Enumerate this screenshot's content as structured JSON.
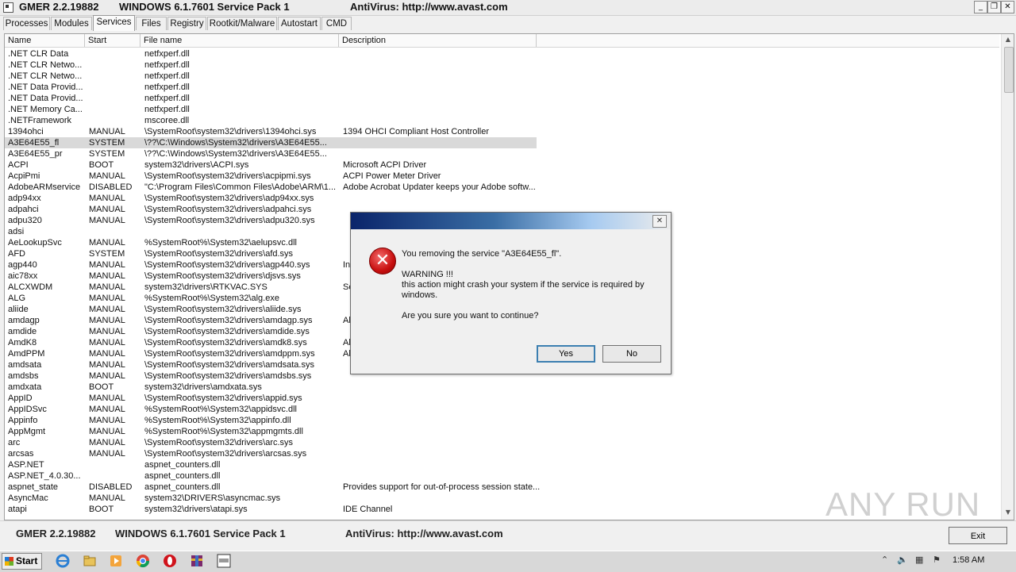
{
  "window": {
    "title_app": "GMER 2.2.19882",
    "title_os": "WINDOWS 6.1.7601 Service Pack 1",
    "title_av": "AntiVirus: http://www.avast.com",
    "minimize": "_",
    "restore": "❐",
    "close": "✕"
  },
  "tabs": [
    {
      "label": "Processes"
    },
    {
      "label": "Modules"
    },
    {
      "label": "Services"
    },
    {
      "label": "Files"
    },
    {
      "label": "Registry"
    },
    {
      "label": "Rootkit/Malware"
    },
    {
      "label": "Autostart"
    },
    {
      "label": "CMD"
    }
  ],
  "active_tab": "Services",
  "columns": [
    "Name",
    "Start",
    "File name",
    "Description"
  ],
  "rows": [
    [
      ".NET CLR Data",
      "",
      "netfxperf.dll",
      ""
    ],
    [
      ".NET CLR Netwo...",
      "",
      "netfxperf.dll",
      ""
    ],
    [
      ".NET CLR Netwo...",
      "",
      "netfxperf.dll",
      ""
    ],
    [
      ".NET Data Provid...",
      "",
      "netfxperf.dll",
      ""
    ],
    [
      ".NET Data Provid...",
      "",
      "netfxperf.dll",
      ""
    ],
    [
      ".NET Memory Ca...",
      "",
      "netfxperf.dll",
      ""
    ],
    [
      ".NETFramework",
      "",
      "mscoree.dll",
      ""
    ],
    [
      "1394ohci",
      "MANUAL",
      "\\SystemRoot\\system32\\drivers\\1394ohci.sys",
      "1394 OHCI Compliant Host Controller"
    ],
    [
      "A3E64E55_fl",
      "SYSTEM",
      "\\??\\C:\\Windows\\System32\\drivers\\A3E64E55...",
      ""
    ],
    [
      "A3E64E55_pr",
      "SYSTEM",
      "\\??\\C:\\Windows\\System32\\drivers\\A3E64E55...",
      ""
    ],
    [
      "ACPI",
      "BOOT",
      "system32\\drivers\\ACPI.sys",
      "Microsoft ACPI Driver"
    ],
    [
      "AcpiPmi",
      "MANUAL",
      "\\SystemRoot\\system32\\drivers\\acpipmi.sys",
      "ACPI Power Meter Driver"
    ],
    [
      "AdobeARMservice",
      "DISABLED",
      "\"C:\\Program Files\\Common Files\\Adobe\\ARM\\1...",
      "Adobe Acrobat Updater keeps your Adobe softw..."
    ],
    [
      "adp94xx",
      "MANUAL",
      "\\SystemRoot\\system32\\drivers\\adp94xx.sys",
      ""
    ],
    [
      "adpahci",
      "MANUAL",
      "\\SystemRoot\\system32\\drivers\\adpahci.sys",
      ""
    ],
    [
      "adpu320",
      "MANUAL",
      "\\SystemRoot\\system32\\drivers\\adpu320.sys",
      ""
    ],
    [
      "adsi",
      "",
      "",
      ""
    ],
    [
      "AeLookupSvc",
      "MANUAL",
      "%SystemRoot%\\System32\\aelupsvc.dll",
      ""
    ],
    [
      "AFD",
      "SYSTEM",
      "\\SystemRoot\\system32\\drivers\\afd.sys",
      ""
    ],
    [
      "agp440",
      "MANUAL",
      "\\SystemRoot\\system32\\drivers\\agp440.sys",
      "In"
    ],
    [
      "aic78xx",
      "MANUAL",
      "\\SystemRoot\\system32\\drivers\\djsvs.sys",
      ""
    ],
    [
      "ALCXWDM",
      "MANUAL",
      "system32\\drivers\\RTKVAC.SYS",
      "Se"
    ],
    [
      "ALG",
      "MANUAL",
      "%SystemRoot%\\System32\\alg.exe",
      ""
    ],
    [
      "aliide",
      "MANUAL",
      "\\SystemRoot\\system32\\drivers\\aliide.sys",
      ""
    ],
    [
      "amdagp",
      "MANUAL",
      "\\SystemRoot\\system32\\drivers\\amdagp.sys",
      "Al"
    ],
    [
      "amdide",
      "MANUAL",
      "\\SystemRoot\\system32\\drivers\\amdide.sys",
      ""
    ],
    [
      "AmdK8",
      "MANUAL",
      "\\SystemRoot\\system32\\drivers\\amdk8.sys",
      "Al"
    ],
    [
      "AmdPPM",
      "MANUAL",
      "\\SystemRoot\\system32\\drivers\\amdppm.sys",
      "Al"
    ],
    [
      "amdsata",
      "MANUAL",
      "\\SystemRoot\\system32\\drivers\\amdsata.sys",
      ""
    ],
    [
      "amdsbs",
      "MANUAL",
      "\\SystemRoot\\system32\\drivers\\amdsbs.sys",
      ""
    ],
    [
      "amdxata",
      "BOOT",
      "system32\\drivers\\amdxata.sys",
      ""
    ],
    [
      "AppID",
      "MANUAL",
      "\\SystemRoot\\system32\\drivers\\appid.sys",
      ""
    ],
    [
      "AppIDSvc",
      "MANUAL",
      "%SystemRoot%\\System32\\appidsvc.dll",
      ""
    ],
    [
      "Appinfo",
      "MANUAL",
      "%SystemRoot%\\System32\\appinfo.dll",
      ""
    ],
    [
      "AppMgmt",
      "MANUAL",
      "%SystemRoot%\\System32\\appmgmts.dll",
      ""
    ],
    [
      "arc",
      "MANUAL",
      "\\SystemRoot\\system32\\drivers\\arc.sys",
      ""
    ],
    [
      "arcsas",
      "MANUAL",
      "\\SystemRoot\\system32\\drivers\\arcsas.sys",
      ""
    ],
    [
      "ASP.NET",
      "",
      "aspnet_counters.dll",
      ""
    ],
    [
      "ASP.NET_4.0.30...",
      "",
      "aspnet_counters.dll",
      ""
    ],
    [
      "aspnet_state",
      "DISABLED",
      "aspnet_counters.dll",
      "Provides support for out-of-process session state..."
    ],
    [
      "AsyncMac",
      "MANUAL",
      "system32\\DRIVERS\\asyncmac.sys",
      ""
    ],
    [
      "atapi",
      "BOOT",
      "system32\\drivers\\atapi.sys",
      "IDE Channel"
    ]
  ],
  "selected_row": 8,
  "status": {
    "app": "GMER 2.2.19882",
    "os": "WINDOWS 6.1.7601 Service Pack 1",
    "av": "AntiVirus: http://www.avast.com",
    "exit_label": "Exit"
  },
  "dialog": {
    "close": "✕",
    "icon": "error-icon",
    "line1": "You removing the service \"A3E64E55_fl\".",
    "warning": "WARNING !!!",
    "line2": "this action might crash your system if the service is required by",
    "line3": "windows.",
    "question": "Are you sure you want to continue?",
    "yes": "Yes",
    "no": "No"
  },
  "taskbar": {
    "start": "Start",
    "clock": "1:58 AM"
  },
  "watermark": "ANY RUN"
}
